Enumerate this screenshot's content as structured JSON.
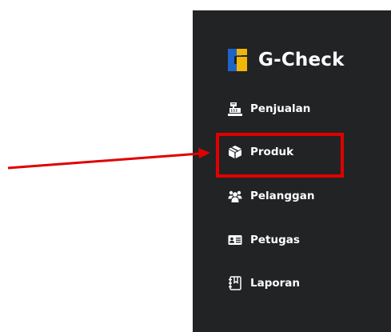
{
  "brand": {
    "name": "G-Check",
    "logo_colors": {
      "blue": "#1e63c6",
      "yellow": "#f2b705"
    }
  },
  "sidebar": {
    "background": "#222325",
    "items": [
      {
        "label": "Penjualan",
        "icon": "cash-register-icon"
      },
      {
        "label": "Produk",
        "icon": "box-icon"
      },
      {
        "label": "Pelanggan",
        "icon": "users-icon"
      },
      {
        "label": "Petugas",
        "icon": "id-card-icon"
      },
      {
        "label": "Laporan",
        "icon": "notebook-icon"
      }
    ]
  },
  "annotation": {
    "color": "#e00000",
    "highlighted_item": "Produk"
  }
}
